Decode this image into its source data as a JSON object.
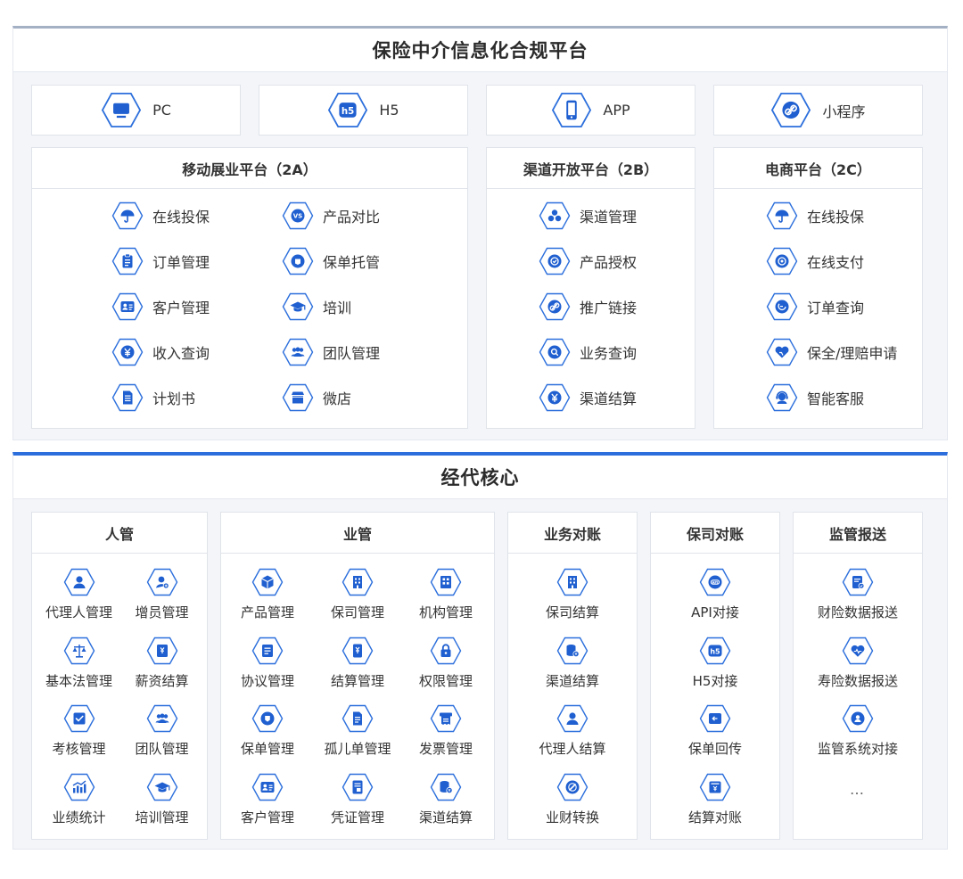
{
  "top": {
    "title": "保险中介信息化合规平台",
    "entries": [
      {
        "label": "PC",
        "icon": "monitor-icon"
      },
      {
        "label": "H5",
        "icon": "h5-icon"
      },
      {
        "label": "APP",
        "icon": "phone-icon"
      },
      {
        "label": "小程序",
        "icon": "link-icon"
      }
    ],
    "panels": [
      {
        "title": "移动展业平台（2A）",
        "items": [
          {
            "label": "在线投保",
            "icon": "umbrella-icon"
          },
          {
            "label": "产品对比",
            "icon": "vs-icon"
          },
          {
            "label": "订单管理",
            "icon": "clipboard-icon"
          },
          {
            "label": "保单托管",
            "icon": "policy-icon"
          },
          {
            "label": "客户管理",
            "icon": "contact-icon"
          },
          {
            "label": "培训",
            "icon": "graduation-icon"
          },
          {
            "label": "收入查询",
            "icon": "yen-icon"
          },
          {
            "label": "团队管理",
            "icon": "team-icon"
          },
          {
            "label": "计划书",
            "icon": "document-icon"
          },
          {
            "label": "微店",
            "icon": "store-icon"
          }
        ]
      },
      {
        "title": "渠道开放平台（2B）",
        "items": [
          {
            "label": "渠道管理",
            "icon": "cluster-icon"
          },
          {
            "label": "产品授权",
            "icon": "check-circle-icon"
          },
          {
            "label": "推广链接",
            "icon": "link-icon"
          },
          {
            "label": "业务查询",
            "icon": "search-icon"
          },
          {
            "label": "渠道结算",
            "icon": "yen-icon"
          }
        ]
      },
      {
        "title": "电商平台（2C）",
        "items": [
          {
            "label": "在线投保",
            "icon": "umbrella-icon"
          },
          {
            "label": "在线支付",
            "icon": "pay-icon"
          },
          {
            "label": "订单查询",
            "icon": "order-search-icon"
          },
          {
            "label": "保全/理赔申请",
            "icon": "heart-hand-icon"
          },
          {
            "label": "智能客服",
            "icon": "service-icon"
          }
        ]
      }
    ]
  },
  "core": {
    "title": "经代核心",
    "panels": [
      {
        "title": "人管",
        "items": [
          {
            "label": "代理人管理",
            "icon": "person-icon"
          },
          {
            "label": "增员管理",
            "icon": "person-add-icon"
          },
          {
            "label": "基本法管理",
            "icon": "scale-icon"
          },
          {
            "label": "薪资结算",
            "icon": "salary-icon"
          },
          {
            "label": "考核管理",
            "icon": "checklist-icon"
          },
          {
            "label": "团队管理",
            "icon": "team-icon"
          },
          {
            "label": "业绩统计",
            "icon": "chart-icon"
          },
          {
            "label": "培训管理",
            "icon": "graduation-icon"
          }
        ]
      },
      {
        "title": "业管",
        "items": [
          {
            "label": "产品管理",
            "icon": "cube-icon"
          },
          {
            "label": "保司管理",
            "icon": "building-icon"
          },
          {
            "label": "机构管理",
            "icon": "office-icon"
          },
          {
            "label": "协议管理",
            "icon": "agreement-icon"
          },
          {
            "label": "结算管理",
            "icon": "settlement-icon"
          },
          {
            "label": "权限管理",
            "icon": "lock-icon"
          },
          {
            "label": "保单管理",
            "icon": "shield-icon"
          },
          {
            "label": "孤儿单管理",
            "icon": "file-icon"
          },
          {
            "label": "发票管理",
            "icon": "invoice-icon"
          },
          {
            "label": "客户管理",
            "icon": "contact-icon"
          },
          {
            "label": "凭证管理",
            "icon": "voucher-icon"
          },
          {
            "label": "渠道结算",
            "icon": "database-icon"
          }
        ]
      },
      {
        "title": "业务对账",
        "items": [
          {
            "label": "保司结算",
            "icon": "building-icon"
          },
          {
            "label": "渠道结算",
            "icon": "database-icon"
          },
          {
            "label": "代理人结算",
            "icon": "person-icon"
          },
          {
            "label": "业财转换",
            "icon": "convert-icon"
          }
        ]
      },
      {
        "title": "保司对账",
        "items": [
          {
            "label": "API对接",
            "icon": "api-icon"
          },
          {
            "label": "H5对接",
            "icon": "h5-icon"
          },
          {
            "label": "保单回传",
            "icon": "return-icon"
          },
          {
            "label": "结算对账",
            "icon": "reconcile-icon"
          }
        ]
      },
      {
        "title": "监管报送",
        "items": [
          {
            "label": "财险数据报送",
            "icon": "report-icon"
          },
          {
            "label": "寿险数据报送",
            "icon": "heart-icon"
          },
          {
            "label": "监管系统对接",
            "icon": "user-circle-icon"
          }
        ],
        "more": "…"
      }
    ]
  },
  "colors": {
    "accent": "#2c6fdc",
    "icon_stroke": "#2c6fdc",
    "icon_fill": "#1f5fd0",
    "divider": "#a4b0c4"
  }
}
